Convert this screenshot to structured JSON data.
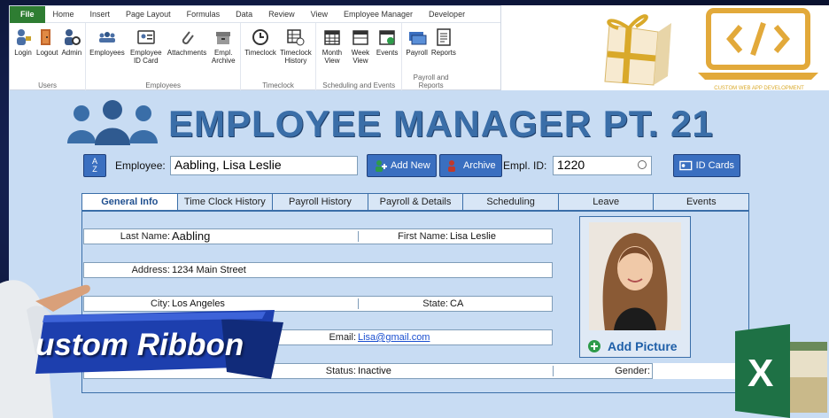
{
  "ribbon": {
    "tabs": [
      "File",
      "Home",
      "Insert",
      "Page Layout",
      "Formulas",
      "Data",
      "Review",
      "View",
      "Employee Manager",
      "Developer"
    ],
    "groups": [
      {
        "label": "Users",
        "buttons": [
          {
            "label": "Login"
          },
          {
            "label": "Logout"
          },
          {
            "label": "Admin"
          }
        ]
      },
      {
        "label": "Employees",
        "buttons": [
          {
            "label": "Employees"
          },
          {
            "label": "Employee ID Card"
          },
          {
            "label": "Attachments"
          },
          {
            "label": "Empl. Archive"
          }
        ]
      },
      {
        "label": "Timeclock",
        "buttons": [
          {
            "label": "Timeclock"
          },
          {
            "label": "Timeclock History"
          }
        ]
      },
      {
        "label": "Scheduling and Events",
        "buttons": [
          {
            "label": "Month View"
          },
          {
            "label": "Week View"
          },
          {
            "label": "Events"
          }
        ]
      },
      {
        "label": "Payroll and Reports",
        "buttons": [
          {
            "label": "Payroll"
          },
          {
            "label": "Reports"
          }
        ]
      }
    ]
  },
  "logo": {
    "caption": "CUSTOM WEB APP DEVELOPMENT"
  },
  "header": {
    "title": "EMPLOYEE MANAGER PT. 21"
  },
  "toolbar": {
    "employee_label": "Employee:",
    "employee_value": "Aabling, Lisa Leslie",
    "add_new": "Add New",
    "archive": "Archive",
    "empl_id_label": "Empl. ID:",
    "empl_id_value": "1220",
    "id_cards": "ID Cards"
  },
  "tabs": [
    "General Info",
    "Time Clock History",
    "Payroll History",
    "Payroll & Details",
    "Scheduling",
    "Leave",
    "Events"
  ],
  "form": {
    "last_name_label": "Last Name:",
    "last_name": "Aabling",
    "first_name_label": "First Name:",
    "first_name": "Lisa Leslie",
    "address_label": "Address:",
    "address": "1234 Main Street",
    "city_label": "City:",
    "city": "Los Angeles",
    "state_label": "State:",
    "state": "CA",
    "email_label": "Email:",
    "email": "Lisa@gmail.com",
    "status_label": "Status:",
    "status": "Inactive",
    "gender_label": "Gender:"
  },
  "photo": {
    "add_picture": "Add Picture"
  },
  "overlay": {
    "banner_text": "ustom Ribbon",
    "excel_letter": "X"
  },
  "colors": {
    "accent": "#3a6ea8",
    "file_tab": "#2e7d32",
    "button": "#3a6fc0",
    "banner": "#1d3fae",
    "excel": "#1e7145"
  }
}
